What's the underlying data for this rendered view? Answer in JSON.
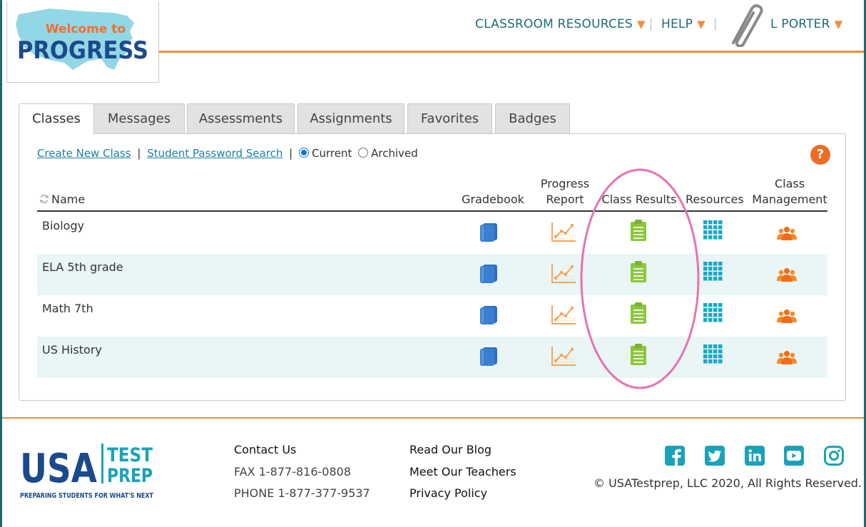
{
  "header": {
    "logo": {
      "line1": "Welcome to",
      "line2": "PROGRESS"
    },
    "nav": {
      "classroom_resources": "CLASSROOM RESOURCES",
      "help": "HELP",
      "user": "L PORTER"
    }
  },
  "tabs": [
    {
      "label": "Classes",
      "active": true
    },
    {
      "label": "Messages",
      "active": false
    },
    {
      "label": "Assessments",
      "active": false
    },
    {
      "label": "Assignments",
      "active": false
    },
    {
      "label": "Favorites",
      "active": false
    },
    {
      "label": "Badges",
      "active": false
    }
  ],
  "toolbar": {
    "create_class": "Create New Class",
    "sep1": "|",
    "password_search": "Student Password Search",
    "sep2": "|",
    "radio_current": "Current",
    "radio_archived": "Archived",
    "selected": "Current",
    "help_icon_text": "?"
  },
  "table": {
    "headers": {
      "name": "Name",
      "gradebook": "Gradebook",
      "progress_line1": "Progress",
      "progress_line2": "Report",
      "class_results": "Class Results",
      "resources": "Resources",
      "management_line1": "Class",
      "management_line2": "Management"
    },
    "rows": [
      {
        "name": "Biology"
      },
      {
        "name": "ELA 5th grade"
      },
      {
        "name": "Math 7th"
      },
      {
        "name": "US History"
      }
    ]
  },
  "icons": {
    "gradebook": "book-icon",
    "progress": "line-chart-icon",
    "class_results": "clipboard-icon",
    "resources": "grid-icon",
    "management": "group-icon",
    "sort": "sort-icon",
    "help": "question-icon",
    "user": "paperclip-icon"
  },
  "colors": {
    "teal": "#1f6b73",
    "orange": "#f28c3f",
    "help_orange": "#f06b23",
    "link_blue": "#1e7ea6",
    "gradebook_blue": "#3a7fd0",
    "results_green": "#8cc63f",
    "resources_teal": "#19a9c4",
    "management_orange": "#f58a2a",
    "highlight_pink": "#e573b1"
  },
  "footer": {
    "logo": {
      "usa": "USA",
      "test": "TEST",
      "prep": "PREP",
      "tagline": "PREPARING STUDENTS FOR WHAT'S NEXT"
    },
    "contact": {
      "title": "Contact Us",
      "fax": "FAX 1-877-816-0808",
      "phone": "PHONE 1-877-377-9537"
    },
    "links": {
      "blog": "Read Our Blog",
      "teachers": "Meet Our Teachers",
      "privacy": "Privacy Policy"
    },
    "social": [
      "facebook-icon",
      "twitter-icon",
      "linkedin-icon",
      "youtube-icon",
      "instagram-icon"
    ],
    "copyright": "© USATestprep, LLC 2020, All Rights Reserved."
  }
}
